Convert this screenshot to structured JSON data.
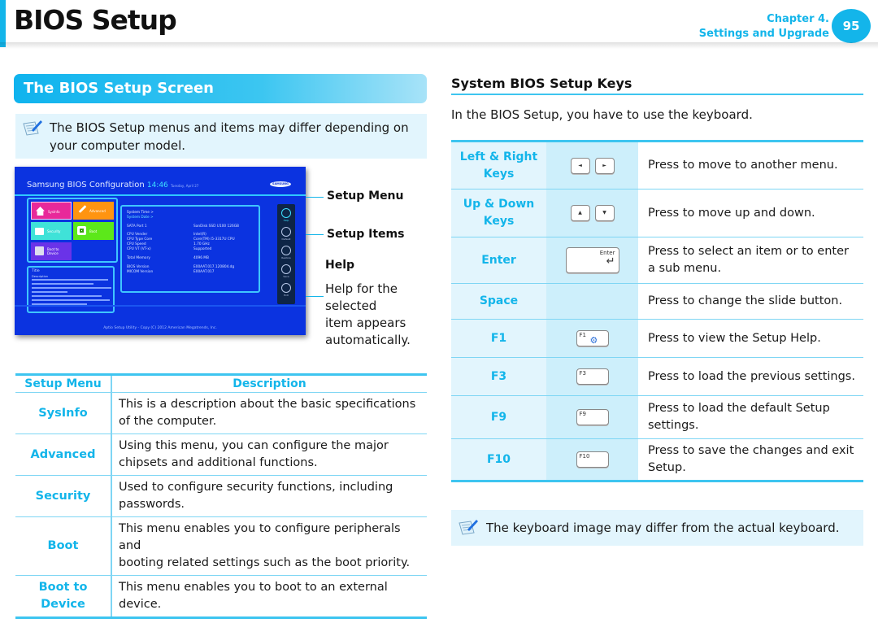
{
  "header": {
    "title": "BIOS Setup",
    "chapter": "Chapter 4.",
    "chapter_name": "Settings and Upgrade",
    "page_number": "95",
    "accent_color": "#13b5ea"
  },
  "left": {
    "section_title": "The BIOS Setup Screen",
    "note": {
      "icon": "note-pencil-icon",
      "line1": "The BIOS Setup menus and items may differ depending on",
      "line2": "your computer model."
    },
    "bios_screenshot": {
      "title": "Samsung BIOS Configuration",
      "time": "14:46",
      "date": "Tuesday, April 27",
      "logo": "SAMSUNG",
      "menu_tiles": [
        {
          "label": "SysInfo",
          "color": "#e8289a"
        },
        {
          "label": "Advanced",
          "color": "#ff9410"
        },
        {
          "label": "Security",
          "color": "#3fe2d8"
        },
        {
          "label": "Boot",
          "color": "#5ce81a"
        },
        {
          "label": "Boot to Device",
          "color": "#6a33e8"
        }
      ],
      "items": [
        {
          "label": "System Time >",
          "value": ""
        },
        {
          "label": "System Date >",
          "value": ""
        },
        {
          "label": "SATA Port 1",
          "value": "SanDisk SSD U100 126GB"
        },
        {
          "label": "CPU Vender",
          "value": "Intel(R)"
        },
        {
          "label": "CPU Type Core",
          "value": "Core(TM) i5-3317U CPU"
        },
        {
          "label": "CPU Speed",
          "value": "1.70 GHz"
        },
        {
          "label": "CPU VT (VT-x)",
          "value": "Supported"
        },
        {
          "label": "Total Memory",
          "value": "4096 MB"
        },
        {
          "label": "BIOS Version",
          "value": "E00AAT.017.120804.dg"
        },
        {
          "label": "MICOM Version",
          "value": "E00AAT.017"
        }
      ],
      "help_title": "Title",
      "help_desc": "Description",
      "side_buttons": [
        "Help",
        "Default",
        "Restore",
        "Save",
        "Exit"
      ],
      "footer": "Aptio Setup Utility - Copy (C) 2012 American Megatrends, Inc."
    },
    "callouts": {
      "setup_menu": "Setup Menu",
      "setup_items": "Setup Items",
      "help": "Help",
      "help_desc_1": "Help for the",
      "help_desc_2": "selected",
      "help_desc_3": "item appears",
      "help_desc_4": "automatically."
    },
    "menu_table": {
      "headers": [
        "Setup Menu",
        "Description"
      ],
      "rows": [
        {
          "menu": "SysInfo",
          "menu2": "",
          "desc1": "This is a description about the basic specifications",
          "desc2": "of the computer."
        },
        {
          "menu": "Advanced",
          "menu2": "",
          "desc1": "Using this menu, you can configure the major",
          "desc2": "chipsets and additional functions."
        },
        {
          "menu": "Security",
          "menu2": "",
          "desc1": "Used to configure security functions, including",
          "desc2": "passwords."
        },
        {
          "menu": "Boot",
          "menu2": "",
          "desc1": "This menu enables you to configure peripherals and",
          "desc2": "booting related settings such as the boot priority."
        },
        {
          "menu": "Boot to",
          "menu2": "Device",
          "desc1": "This menu enables you to boot to an external",
          "desc2": "device."
        }
      ]
    }
  },
  "right": {
    "heading": "System BIOS Setup Keys",
    "intro": "In the BIOS Setup, you have to use the keyboard.",
    "keys": [
      {
        "name1": "Left & Right",
        "name2": "Keys",
        "keycaps": [
          "◄",
          "►"
        ],
        "desc1": "Press to move to another menu.",
        "desc2": ""
      },
      {
        "name1": "Up & Down",
        "name2": "Keys",
        "keycaps": [
          "▲",
          "▼"
        ],
        "desc1": "Press to move up and down.",
        "desc2": ""
      },
      {
        "name1": "Enter",
        "name2": "",
        "keycap_label": "Enter",
        "keycap_arrow": "↵",
        "desc1": "Press to select an item or to enter",
        "desc2": "a sub menu."
      },
      {
        "name1": "Space",
        "name2": "",
        "desc1": "Press to change the slide button.",
        "desc2": ""
      },
      {
        "name1": "F1",
        "name2": "",
        "keycap_label": "F1",
        "keycap_icon": "⚙",
        "desc1": "Press to view the Setup Help.",
        "desc2": ""
      },
      {
        "name1": "F3",
        "name2": "",
        "keycap_label": "F3",
        "desc1": "Press to load the previous settings.",
        "desc2": ""
      },
      {
        "name1": "F9",
        "name2": "",
        "keycap_label": "F9",
        "desc1": "Press to load the default Setup",
        "desc2": "settings."
      },
      {
        "name1": "F10",
        "name2": "",
        "keycap_label": "F10",
        "desc1": "Press to save the changes and exit",
        "desc2": "Setup."
      }
    ],
    "note": {
      "icon": "note-pencil-icon",
      "text": "The keyboard image may differ from the actual keyboard."
    }
  }
}
